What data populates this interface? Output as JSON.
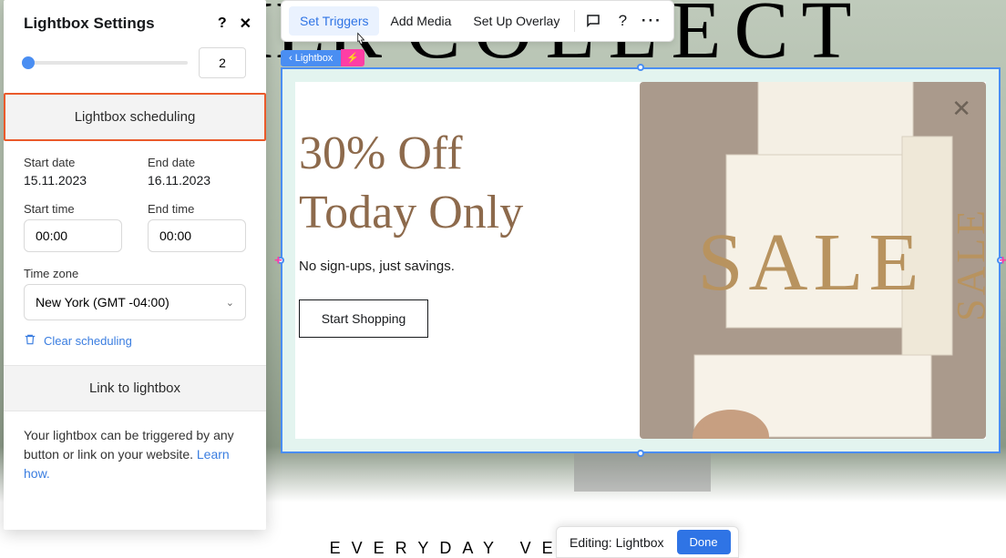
{
  "bg": {
    "title_thin": "MER",
    "title_bold": "COLLECT",
    "subtitle": "EVERYDAY                 VERYONE"
  },
  "panel": {
    "title": "Lightbox Settings",
    "slider_value": "2",
    "scheduling_title": "Lightbox scheduling",
    "start_date_label": "Start date",
    "start_date": "15.11.2023",
    "end_date_label": "End date",
    "end_date": "16.11.2023",
    "start_time_label": "Start time",
    "start_time": "00:00",
    "end_time_label": "End time",
    "end_time": "00:00",
    "timezone_label": "Time zone",
    "timezone_value": "New York (GMT -04:00)",
    "clear_label": "Clear scheduling",
    "link_title": "Link to lightbox",
    "link_desc": "Your lightbox can be triggered by any button or link on your website.",
    "learn": "Learn how."
  },
  "toolbar": {
    "set_triggers": "Set Triggers",
    "add_media": "Add Media",
    "set_up_overlay": "Set Up Overlay"
  },
  "breadcrumb": {
    "label": "‹ Lightbox",
    "bolt": "⚡"
  },
  "lightbox": {
    "heading_line1": "30% Off",
    "heading_line2": "Today Only",
    "sub": "No sign-ups, just savings.",
    "cta": "Start Shopping",
    "sale_big": "SALE",
    "sale_side": "SALE"
  },
  "status": {
    "editing": "Editing: Lightbox",
    "done": "Done"
  }
}
